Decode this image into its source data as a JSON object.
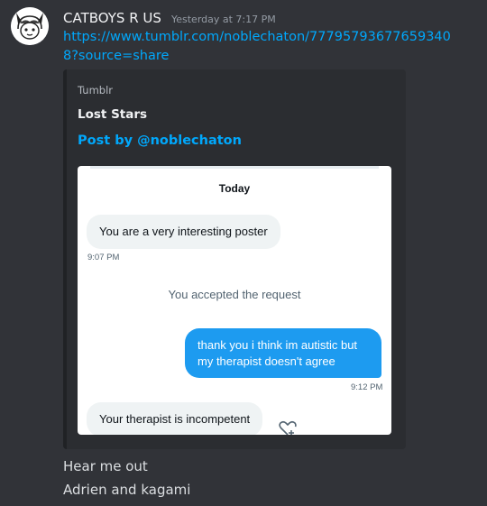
{
  "message": {
    "author": "CATBOYS R US",
    "timestamp": "Yesterday at 7:17 PM",
    "link": "https://www.tumblr.com/noblechaton/777957936776593408?source=share"
  },
  "embed": {
    "provider": "Tumblr",
    "title": "Lost Stars",
    "author": "Post by @noblechaton",
    "image": {
      "day_label": "Today",
      "msg1": "You are a very interesting poster",
      "msg1_time": "9:07 PM",
      "system": "You accepted the request",
      "msg2": "thank you i think im autistic but my therapist doesn't agree",
      "msg2_time": "9:12 PM",
      "msg3": "Your therapist is incompetent",
      "react_icon": "heart-plus-icon"
    }
  },
  "followups": [
    "Hear me out",
    "Adrien and kagami"
  ],
  "colors": {
    "background": "#313338",
    "embed": "#2b2d31",
    "link": "#00a8fc",
    "dm_blue": "#1d9bf0"
  }
}
